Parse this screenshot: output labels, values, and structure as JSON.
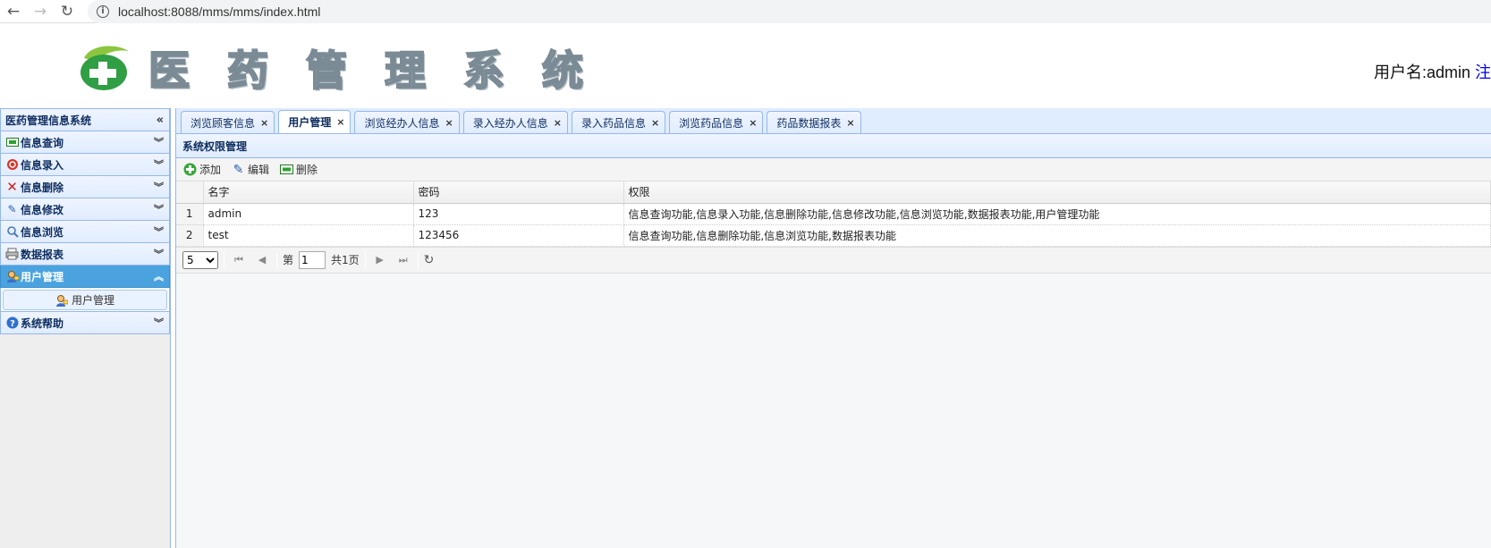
{
  "browser": {
    "url": "localhost:8088/mms/mms/index.html",
    "back_icon": "back-arrow-icon",
    "forward_icon": "forward-arrow-icon",
    "reload_icon": "reload-icon"
  },
  "header": {
    "title_chars": [
      "医",
      "药",
      "管",
      "理",
      "系",
      "统"
    ],
    "user_label": "用户名:admin",
    "logout_label": "注"
  },
  "sidebar": {
    "title": "医药管理信息系统",
    "collapse_icon": "«",
    "items": [
      {
        "label": "信息查询",
        "icon": "query-icon"
      },
      {
        "label": "信息录入",
        "icon": "entry-icon"
      },
      {
        "label": "信息删除",
        "icon": "delete-icon"
      },
      {
        "label": "信息修改",
        "icon": "edit-icon"
      },
      {
        "label": "信息浏览",
        "icon": "browse-icon"
      },
      {
        "label": "数据报表",
        "icon": "print-icon"
      },
      {
        "label": "用户管理",
        "icon": "user-icon"
      },
      {
        "label": "系统帮助",
        "icon": "help-icon"
      }
    ],
    "sub_item": "用户管理"
  },
  "tabs": [
    {
      "label": "浏览顾客信息"
    },
    {
      "label": "用户管理"
    },
    {
      "label": "浏览经办人信息"
    },
    {
      "label": "录入经办人信息"
    },
    {
      "label": "录入药品信息"
    },
    {
      "label": "浏览药品信息"
    },
    {
      "label": "药品数据报表"
    }
  ],
  "panel": {
    "title": "系统权限管理",
    "toolbar": {
      "add": "添加",
      "edit": "编辑",
      "delete": "删除"
    },
    "columns": {
      "name": "名字",
      "password": "密码",
      "permissions": "权限"
    },
    "rows": [
      {
        "num": "1",
        "name": "admin",
        "password": "123",
        "permissions": "信息查询功能,信息录入功能,信息删除功能,信息修改功能,信息浏览功能,数据报表功能,用户管理功能"
      },
      {
        "num": "2",
        "name": "test",
        "password": "123456",
        "permissions": "信息查询功能,信息删除功能,信息浏览功能,数据报表功能"
      }
    ],
    "pager": {
      "page_size": "5",
      "page_prefix": "第",
      "page_value": "1",
      "total_pages": "共1页"
    }
  },
  "colors": {
    "accent_blue": "#4aa3df",
    "panel_border": "#95b8e7",
    "header_bg": "#e0ecff"
  }
}
